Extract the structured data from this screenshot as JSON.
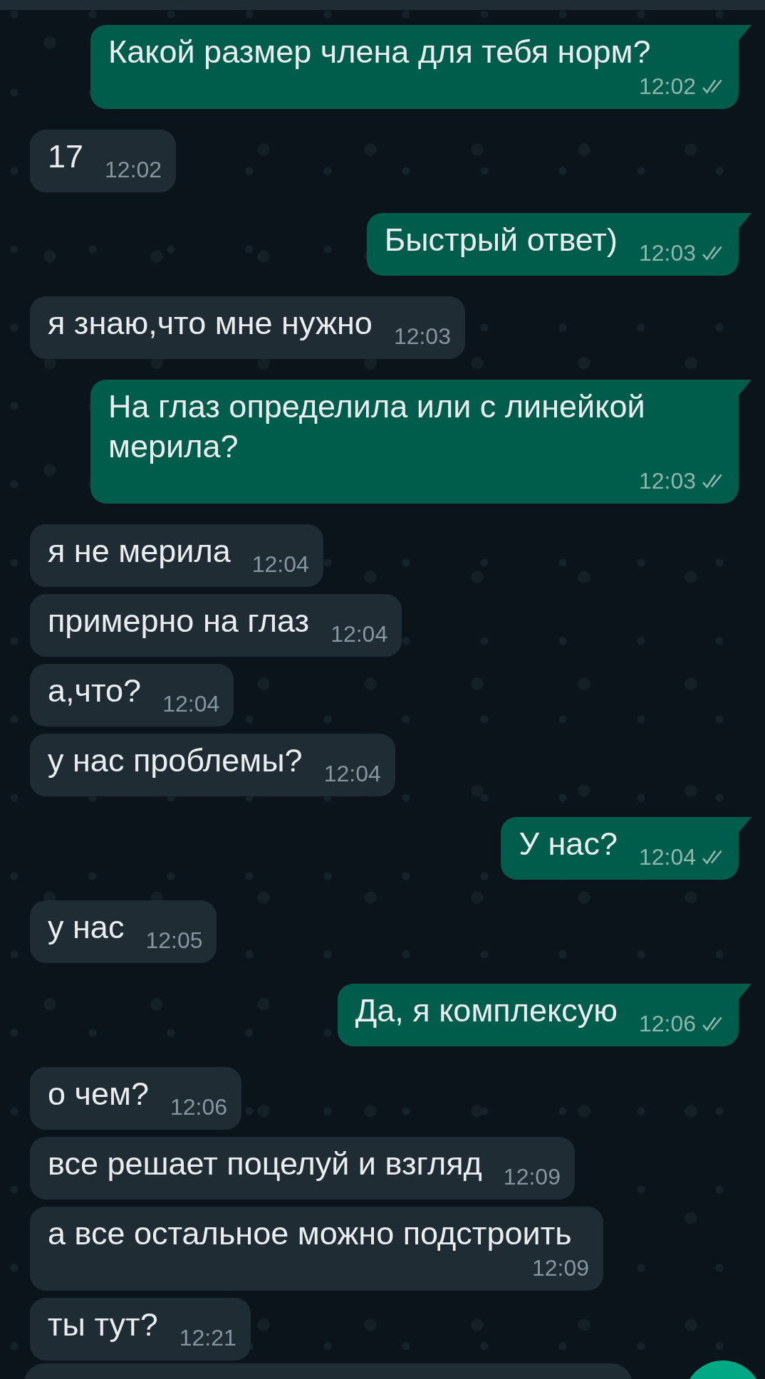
{
  "messages": [
    {
      "kind": "outgoing",
      "text": "Какой размер члена для тебя норм?",
      "time": "12:02",
      "read": false
    },
    {
      "kind": "incoming",
      "text": "17",
      "time": "12:02"
    },
    {
      "kind": "outgoing",
      "text": "Быстрый ответ)",
      "time": "12:03",
      "read": false
    },
    {
      "kind": "incoming",
      "text": "я знаю,что мне нужно",
      "time": "12:03"
    },
    {
      "kind": "outgoing",
      "text": "На глаз определила или с линейкой мерила?",
      "time": "12:03",
      "read": false
    },
    {
      "kind": "incoming",
      "text": "я не мерила",
      "time": "12:04"
    },
    {
      "kind": "incoming",
      "text": "примерно на глаз",
      "time": "12:04"
    },
    {
      "kind": "incoming",
      "text": "а,что?",
      "time": "12:04"
    },
    {
      "kind": "incoming",
      "text": "у нас проблемы?",
      "time": "12:04"
    },
    {
      "kind": "outgoing",
      "text": "У нас?",
      "time": "12:04",
      "read": false
    },
    {
      "kind": "incoming",
      "text": "у нас",
      "time": "12:05"
    },
    {
      "kind": "outgoing",
      "text": "Да, я комплексую",
      "time": "12:06",
      "read": false
    },
    {
      "kind": "incoming",
      "text": "о чем?",
      "time": "12:06"
    },
    {
      "kind": "incoming",
      "text": "все решает поцелуй и взгляд",
      "time": "12:09"
    },
    {
      "kind": "incoming",
      "text": "а все остальное можно подстроить",
      "time": "12:09"
    },
    {
      "kind": "incoming",
      "text": "ты тут?",
      "time": "12:21"
    }
  ]
}
